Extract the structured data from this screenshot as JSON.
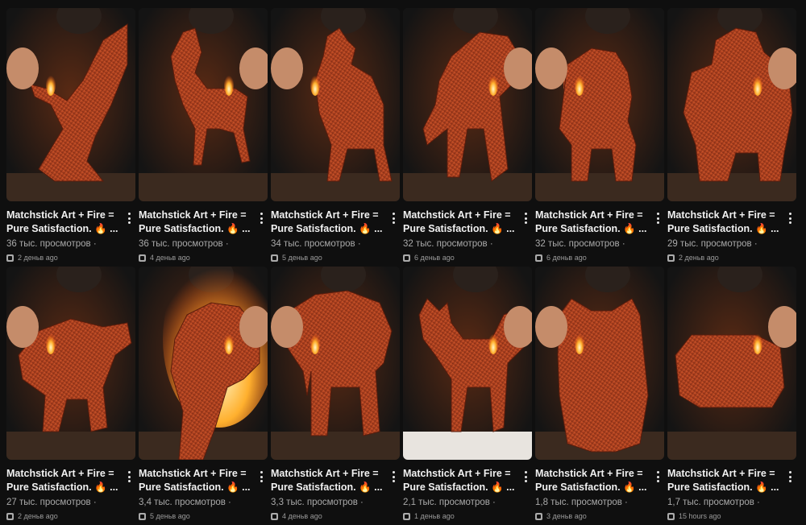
{
  "videos": [
    {
      "title": "Matchstick Art + Fire =\nPure Satisfaction. 🔥 ...",
      "views": "36 тыс. просмотров ·",
      "age": "2 деньв ago",
      "subject": "eagle",
      "icon": "eagle-sculpture-icon",
      "hair": 0
    },
    {
      "title": "Matchstick Art + Fire =\nPure Satisfaction. 🔥 ...",
      "views": "36 тыс. просмотров ·",
      "age": "4 деньв ago",
      "subject": "horse",
      "icon": "horse-sculpture-icon",
      "hair": 0
    },
    {
      "title": "Matchstick Art + Fire =\nPure Satisfaction. 🔥 ...",
      "views": "34 тыс. просмотров ·",
      "age": "5 деньв ago",
      "subject": "wolf",
      "icon": "wolf-sculpture-icon",
      "hair": 0
    },
    {
      "title": "Matchstick Art + Fire =\nPure Satisfaction. 🔥 ...",
      "views": "32 тыс. просмотров ·",
      "age": "6 деньв ago",
      "subject": "tiger",
      "icon": "tiger-sculpture-icon",
      "hair": 0
    },
    {
      "title": "Matchstick Art + Fire =\nPure Satisfaction. 🔥 ...",
      "views": "32 тыс. просмотров ·",
      "age": "6 деньв ago",
      "subject": "lion",
      "icon": "lion-sculpture-icon",
      "hair": 1
    },
    {
      "title": "Matchstick Art + Fire =\nPure Satisfaction. 🔥 ...",
      "views": "29 тыс. просмотров ·",
      "age": "2 деньв ago",
      "subject": "gorilla",
      "icon": "gorilla-sculpture-icon",
      "hair": 0
    },
    {
      "title": "Matchstick Art + Fire =\nPure Satisfaction. 🔥 ...",
      "views": "27 тыс. просмотров ·",
      "age": "2 деньв ago",
      "subject": "panther",
      "icon": "panther-sculpture-icon",
      "hair": 0
    },
    {
      "title": "Matchstick Art + Fire =\nPure Satisfaction. 🔥 ...",
      "views": "3,4 тыс. просмотров ·",
      "age": "5 деньв ago",
      "subject": "tiger-fire",
      "icon": "tiger-on-fire-icon",
      "hair": 0
    },
    {
      "title": "Matchstick Art + Fire =\nPure Satisfaction. 🔥 ...",
      "views": "3,3 тыс. просмотров ·",
      "age": "4 деньв ago",
      "subject": "elephant",
      "icon": "elephant-sculpture-icon",
      "hair": 0
    },
    {
      "title": "Matchstick Art + Fire =\nPure Satisfaction. 🔥 ...",
      "views": "2,1 тыс. просмотров ·",
      "age": "1 деньв ago",
      "subject": "fox",
      "icon": "fox-sculpture-icon",
      "hair": 0
    },
    {
      "title": "Matchstick Art + Fire =\nPure Satisfaction. 🔥 ...",
      "views": "1,8 тыс. просмотров ·",
      "age": "3 деньв ago",
      "subject": "owl",
      "icon": "owl-sculpture-icon",
      "hair": 0
    },
    {
      "title": "Matchstick Art + Fire =\nPure Satisfaction. 🔥 ...",
      "views": "1,7 тыс. просмотров ·",
      "age": "15 hours ago",
      "subject": "car",
      "icon": "car-sculpture-icon",
      "hair": 0
    }
  ],
  "theme": {
    "background": "#0f0f0f",
    "text": "#f1f1f1",
    "muted": "#aaaaaa",
    "match": "#c2502a",
    "flame": "#ffb02e"
  }
}
